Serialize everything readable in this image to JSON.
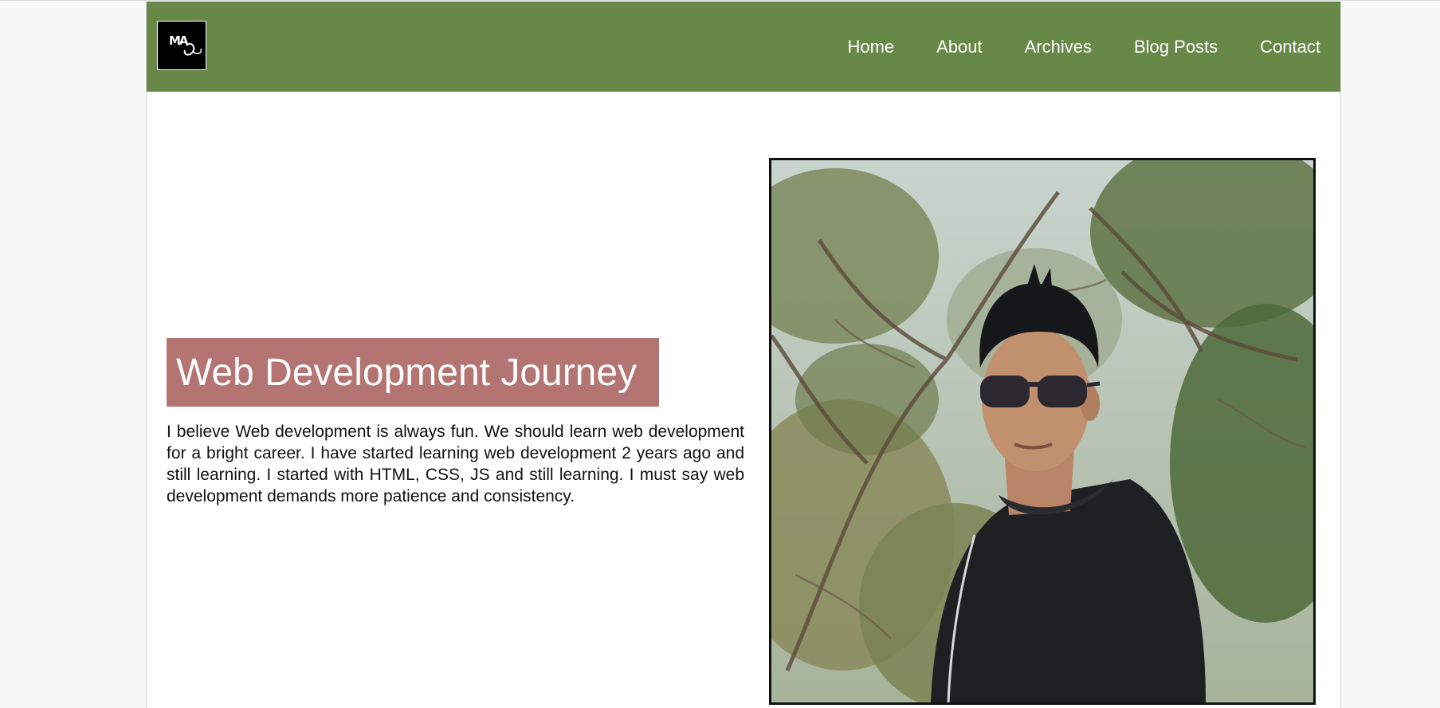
{
  "header": {
    "logo_text": "MA",
    "nav": [
      {
        "label": "Home"
      },
      {
        "label": "About"
      },
      {
        "label": "Archives"
      },
      {
        "label": "Blog Posts"
      },
      {
        "label": "Contact"
      }
    ]
  },
  "hero": {
    "title": "Web Development Journey",
    "paragraph": "I believe Web development is always fun. We should learn web development for a bright career. I have started learning web development 2 years ago and still learning. I started with HTML, CSS, JS and still learning. I must say web development demands more patience and consistency."
  },
  "colors": {
    "navbar": "#688848",
    "title_bg": "#b47472",
    "page_bg": "#ffffff"
  },
  "icons": {
    "logo": "ma-monogram-icon"
  }
}
